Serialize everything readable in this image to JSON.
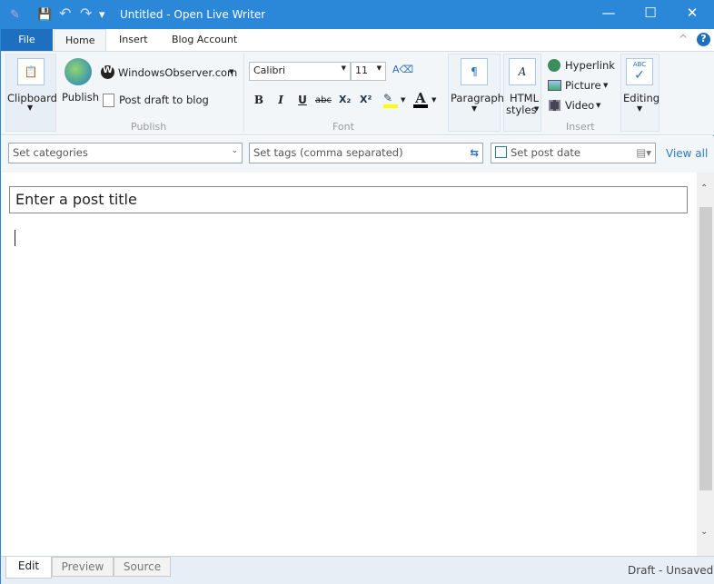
{
  "window": {
    "title": "Untitled - Open Live Writer",
    "minimize": "—",
    "maximize": "☐",
    "close": "✕"
  },
  "quick_access": {
    "app": "✎",
    "save": "💾",
    "undo": "↶",
    "redo": "↷",
    "more": "▾"
  },
  "tabs": [
    "File",
    "Home",
    "Insert",
    "Blog Account"
  ],
  "ribbon": {
    "clipboard": "Clipboard",
    "publish": "Publish",
    "blog": "WindowsObserver.com",
    "post_draft": "Post draft to blog",
    "publish_group": "Publish",
    "font_name": "Calibri",
    "font_size": "11",
    "font_group": "Font",
    "bold": "B",
    "italic": "I",
    "underline": "U",
    "strike": "abc",
    "sub": "X₂",
    "sup": "X²",
    "paragraph": "Paragraph",
    "html_styles_1": "HTML",
    "html_styles_2": "styles",
    "hyperlink": "Hyperlink",
    "picture": "Picture",
    "video": "Video",
    "insert_group": "Insert",
    "editing": "Editing",
    "spell": "ABC"
  },
  "meta": {
    "categories": "Set categories",
    "tags": "Set tags (comma separated)",
    "post_date": "Set post date",
    "view_all": "View all"
  },
  "editor": {
    "title_placeholder": "Enter a post title"
  },
  "bottom_tabs": [
    "Edit",
    "Preview",
    "Source"
  ],
  "status": "Draft - Unsaved",
  "colors": {
    "accent": "#2b88d8",
    "file_tab": "#1e6fc0",
    "highlight": "#ffff00"
  }
}
